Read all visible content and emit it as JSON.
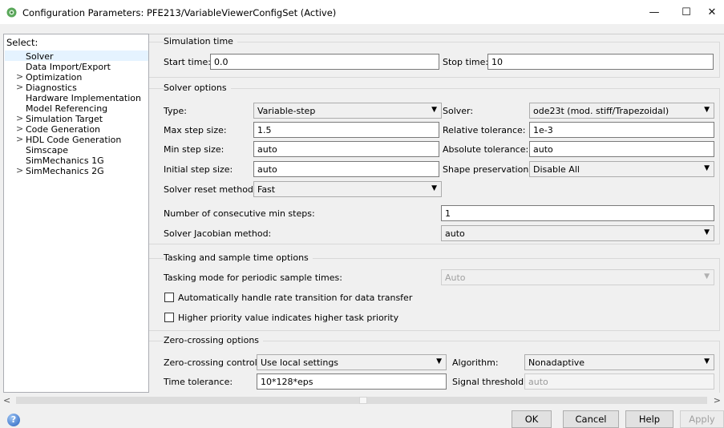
{
  "window": {
    "title": "Configuration Parameters: PFE213/VariableViewerConfigSet (Active)",
    "minimize": "—",
    "maximize": "☐",
    "close": "✕"
  },
  "tree": {
    "label": "Select:",
    "items": [
      {
        "label": "Solver",
        "expandable": false,
        "selected": true
      },
      {
        "label": "Data Import/Export",
        "expandable": false
      },
      {
        "label": "Optimization",
        "expandable": true
      },
      {
        "label": "Diagnostics",
        "expandable": true
      },
      {
        "label": "Hardware Implementation",
        "expandable": false
      },
      {
        "label": "Model Referencing",
        "expandable": false
      },
      {
        "label": "Simulation Target",
        "expandable": true
      },
      {
        "label": "Code Generation",
        "expandable": true
      },
      {
        "label": "HDL Code Generation",
        "expandable": true
      },
      {
        "label": "Simscape",
        "expandable": false
      },
      {
        "label": "SimMechanics 1G",
        "expandable": false
      },
      {
        "label": "SimMechanics 2G",
        "expandable": true
      }
    ]
  },
  "simulation_time": {
    "group": "Simulation time",
    "start_label": "Start time:",
    "start_value": "0.0",
    "stop_label": "Stop time:",
    "stop_value": "10"
  },
  "solver_options": {
    "group": "Solver options",
    "type_label": "Type:",
    "type_value": "Variable-step",
    "solver_label": "Solver:",
    "solver_value": "ode23t (mod. stiff/Trapezoidal)",
    "max_step_label": "Max step size:",
    "max_step_value": "1.5",
    "rel_tol_label": "Relative tolerance:",
    "rel_tol_value": "1e-3",
    "min_step_label": "Min step size:",
    "min_step_value": "auto",
    "abs_tol_label": "Absolute tolerance:",
    "abs_tol_value": "auto",
    "init_step_label": "Initial step size:",
    "init_step_value": "auto",
    "shape_label": "Shape preservation:",
    "shape_value": "Disable All",
    "reset_label": "Solver reset method:",
    "reset_value": "Fast",
    "consec_label": "Number of consecutive min steps:",
    "consec_value": "1",
    "jacobian_label": "Solver Jacobian method:",
    "jacobian_value": "auto"
  },
  "tasking": {
    "group": "Tasking and sample time options",
    "mode_label": "Tasking mode for periodic sample times:",
    "mode_value": "Auto",
    "auto_rate_label": "Automatically handle rate transition for data transfer",
    "auto_rate_checked": false,
    "priority_label": "Higher priority value indicates higher task priority",
    "priority_checked": false
  },
  "zero_crossing": {
    "group": "Zero-crossing options",
    "control_label": "Zero-crossing control:",
    "control_value": "Use local settings",
    "algorithm_label": "Algorithm:",
    "algorithm_value": "Nonadaptive",
    "time_tol_label": "Time tolerance:",
    "time_tol_value": "10*128*eps",
    "signal_label": "Signal threshold:",
    "signal_value": "auto"
  },
  "scroll": {
    "left": "<",
    "right": ">"
  },
  "buttons": {
    "help_icon": "?",
    "ok": "OK",
    "cancel": "Cancel",
    "help": "Help",
    "apply": "Apply"
  }
}
